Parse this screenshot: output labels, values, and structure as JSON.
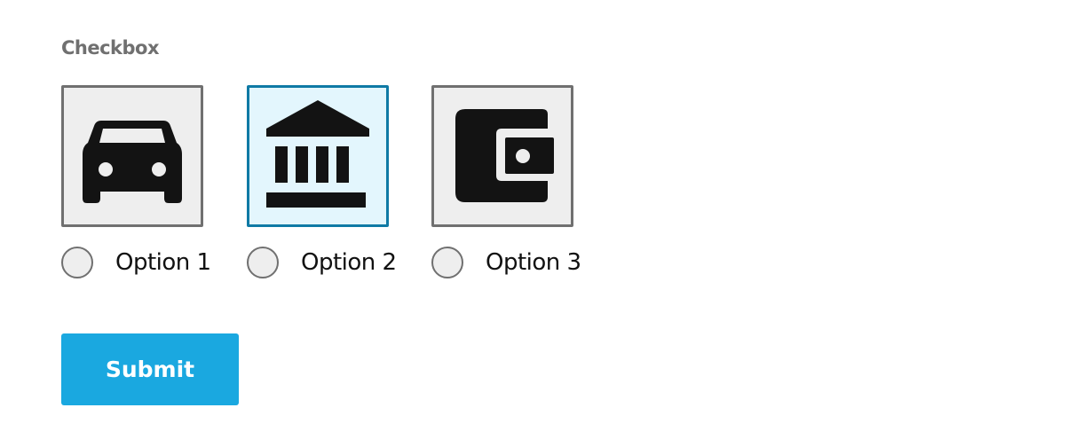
{
  "field": {
    "label": "Checkbox"
  },
  "options": [
    {
      "label": "Option 1",
      "icon": "car-icon",
      "selected": false,
      "checked": false
    },
    {
      "label": "Option 2",
      "icon": "bank-icon",
      "selected": true,
      "checked": false
    },
    {
      "label": "Option 3",
      "icon": "wallet-icon",
      "selected": false,
      "checked": false
    }
  ],
  "submit": {
    "label": "Submit"
  },
  "colors": {
    "tile_border": "#707070",
    "tile_background": "#eeeeee",
    "tile_selected_border": "#0f7aa5",
    "tile_selected_background": "#e3f6fd",
    "button_background": "#1aa8e0",
    "label_text": "#707070"
  }
}
